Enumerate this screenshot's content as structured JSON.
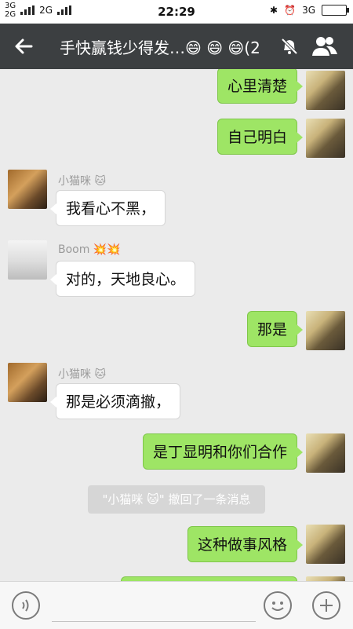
{
  "status": {
    "net1_top": "3G",
    "net1_bottom": "2G",
    "net2": "2G",
    "time": "22:29",
    "right_net": "3G"
  },
  "header": {
    "title": "手快赢钱少得发…😄 😄 😄(2"
  },
  "messages": [
    {
      "side": "me",
      "text": "心里清楚"
    },
    {
      "side": "me",
      "text": "自己明白"
    },
    {
      "side": "other",
      "sender": "小猫咪 🐱",
      "text": "我看心不黑，"
    },
    {
      "side": "other",
      "sender": "Boom 💥💥",
      "text": "对的，天地良心。"
    },
    {
      "side": "me",
      "text": "那是"
    },
    {
      "side": "other",
      "sender": "小猫咪 🐱",
      "text": "那是必须滴撤，"
    },
    {
      "side": "me",
      "text": "是丁显明和你们合作"
    },
    {
      "side": "system",
      "text": "\"小猫咪 🐱\" 撤回了一条消息"
    },
    {
      "side": "me",
      "text": "这种做事风格"
    }
  ],
  "colors": {
    "header_bg": "#3c3f41",
    "chat_bg": "#ebebeb",
    "my_bubble": "#9ee565",
    "other_bubble": "#ffffff"
  },
  "icons": {
    "back": "arrow-left-icon",
    "mute": "bell-off-icon",
    "group": "group-icon",
    "voice": "voice-icon",
    "emoji": "emoji-icon",
    "more": "plus-icon"
  }
}
